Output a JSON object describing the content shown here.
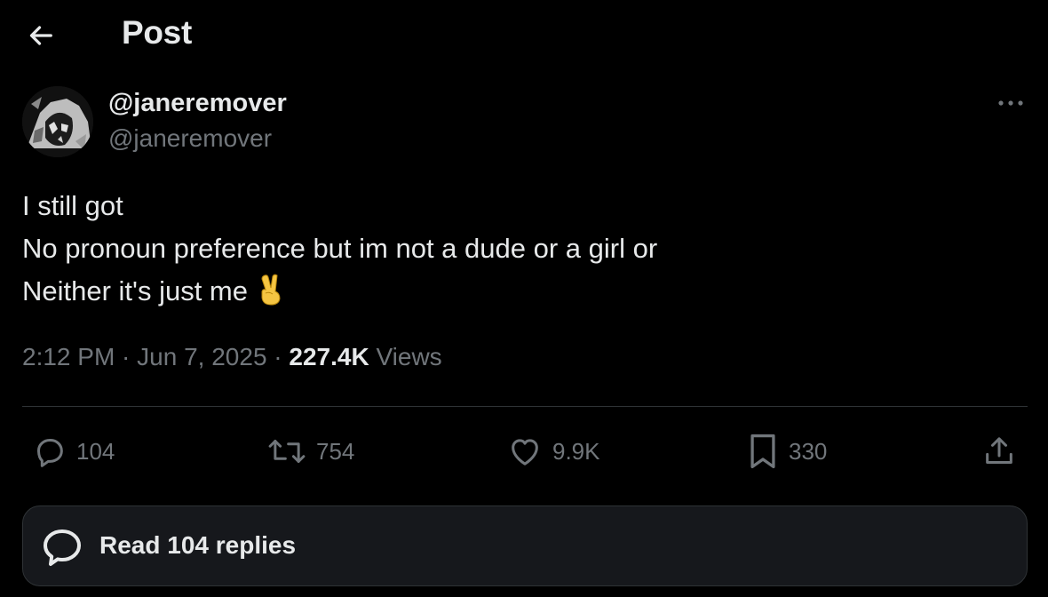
{
  "header": {
    "back_icon": "arrow-left-icon",
    "title": "Post"
  },
  "author": {
    "display_name": "@janeremover",
    "handle": "@janeremover",
    "avatar": "grayscale-portrait"
  },
  "post": {
    "lines": [
      "I still got",
      "No pronoun preference but im not a dude or a girl or",
      "Neither it's just me"
    ],
    "emoji": "victory-hand"
  },
  "meta": {
    "time": "2:12 PM",
    "sep1": " · ",
    "date": "Jun 7, 2025",
    "sep2": " · ",
    "views_count": "227.4K",
    "views_label": "Views"
  },
  "actions": {
    "reply": {
      "icon": "reply-icon",
      "count": "104"
    },
    "repost": {
      "icon": "repost-icon",
      "count": "754"
    },
    "like": {
      "icon": "heart-icon",
      "count": "9.9K"
    },
    "bookmark": {
      "icon": "bookmark-icon",
      "count": "330"
    },
    "share": {
      "icon": "share-icon"
    }
  },
  "replies_button": {
    "icon": "chat-bubble-icon",
    "label": "Read 104 replies"
  },
  "colors": {
    "background": "#000000",
    "text_primary": "#e7e9ea",
    "text_secondary": "#71767b",
    "divider": "#2f3336",
    "button_bg": "#16181c",
    "emoji": "#f5c542"
  }
}
